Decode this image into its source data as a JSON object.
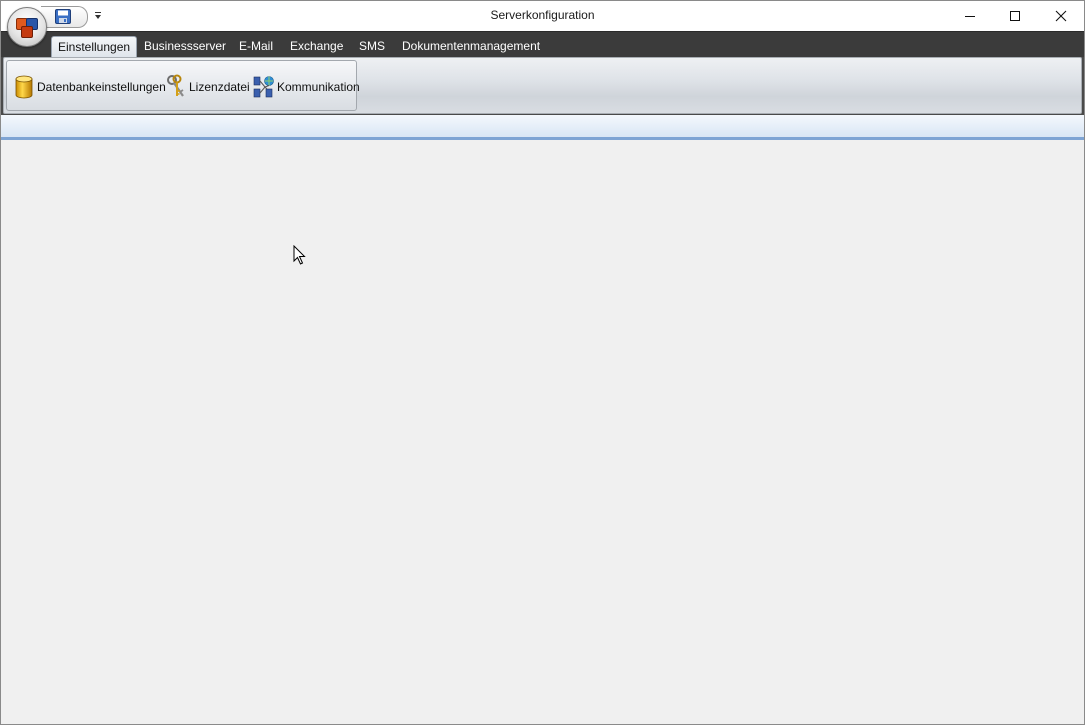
{
  "window": {
    "title": "Serverkonfiguration"
  },
  "quick_access": {
    "icons": [
      "app-orb-icon",
      "save-icon",
      "qat-dropdown-icon"
    ]
  },
  "window_controls": {
    "icons": [
      "minimize-icon",
      "maximize-icon",
      "close-icon"
    ]
  },
  "tabs": [
    {
      "label": "Einstellungen",
      "active": true
    },
    {
      "label": "Businessserver",
      "active": false
    },
    {
      "label": "E-Mail",
      "active": false
    },
    {
      "label": "Exchange",
      "active": false
    },
    {
      "label": "SMS",
      "active": false
    },
    {
      "label": "Dokumentenmanagement",
      "active": false
    }
  ],
  "ribbon": {
    "buttons": [
      {
        "label": "Datenbankeinstellungen",
        "icon": "database-icon"
      },
      {
        "label": "Lizenzdatei",
        "icon": "keys-icon"
      },
      {
        "label": "Kommunikation",
        "icon": "network-icon"
      }
    ]
  },
  "colors": {
    "tab_strip": "#3b3b3b",
    "accent_blue": "#7ea4d4",
    "content_bg": "#f0f0f0"
  }
}
